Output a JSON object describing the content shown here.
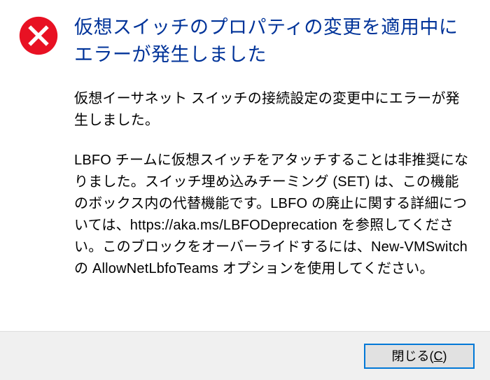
{
  "dialog": {
    "title": "仮想スイッチのプロパティの変更を適用中にエラーが発生しました",
    "paragraph1": "仮想イーサネット スイッチの接続設定の変更中にエラーが発生しました。",
    "paragraph2": "LBFO チームに仮想スイッチをアタッチすることは非推奨になりました。スイッチ埋め込みチーミング (SET) は、この機能のボックス内の代替機能です。LBFO の廃止に関する詳細については、https://aka.ms/LBFODeprecation を参照してください。このブロックをオーバーライドするには、New-VMSwitch の AllowNetLbfoTeams オプションを使用してください。",
    "close_button_label": "閉じる",
    "close_button_mnemonic": "C",
    "icon_name": "error-icon",
    "colors": {
      "title_blue": "#003399",
      "footer_bg": "#f0f0f0",
      "button_border_focus": "#0078d7",
      "error_red": "#e81123"
    }
  }
}
